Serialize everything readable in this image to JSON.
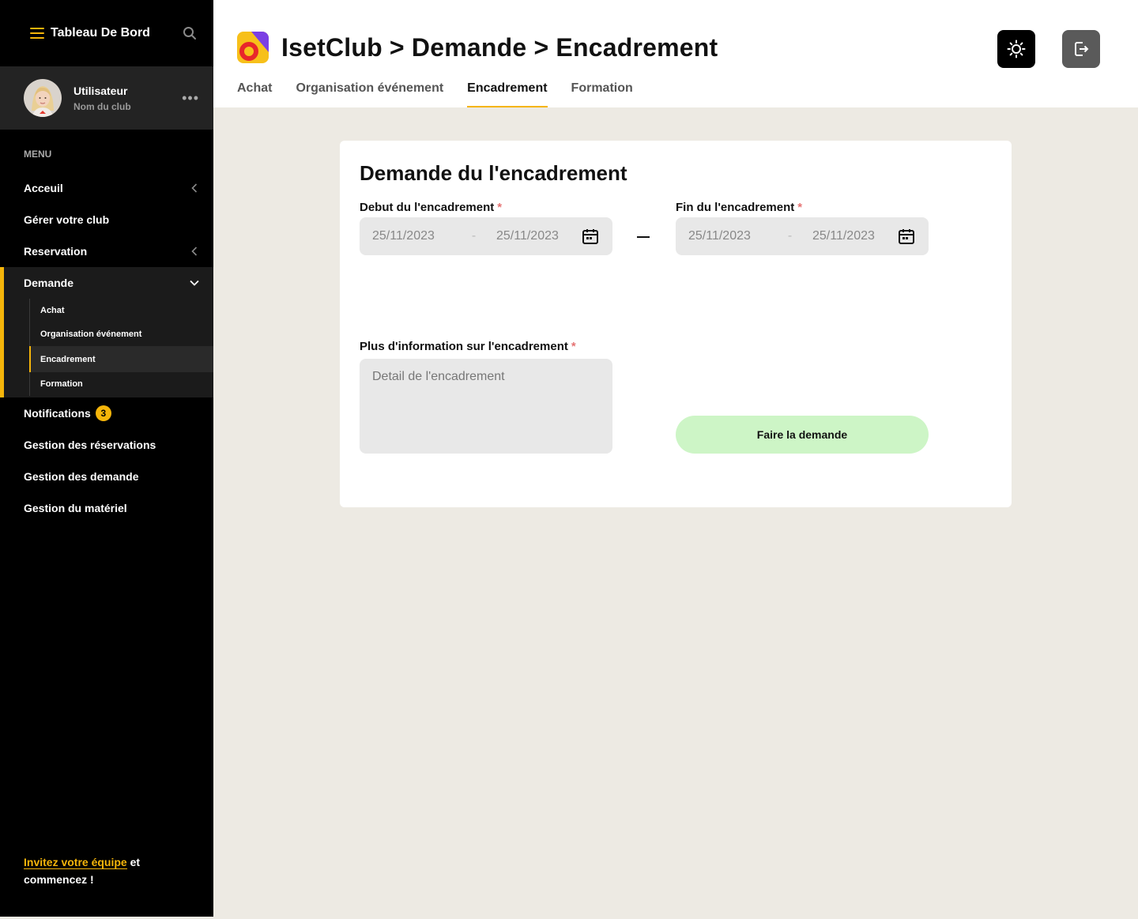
{
  "sidebar": {
    "brand": "Tableau De Bord",
    "user": {
      "name": "Utilisateur",
      "club": "Nom du club"
    },
    "menu_label": "MENU",
    "items": [
      {
        "label": "Acceuil"
      },
      {
        "label": "Gérer votre club"
      },
      {
        "label": "Reservation"
      },
      {
        "label": "Demande"
      },
      {
        "label": "Notifications",
        "badge": "3"
      },
      {
        "label": "Gestion des réservations"
      },
      {
        "label": "Gestion des demande"
      },
      {
        "label": "Gestion du matériel"
      }
    ],
    "demande_sub": [
      {
        "label": "Achat"
      },
      {
        "label": "Organisation événement"
      },
      {
        "label": "Encadrement"
      },
      {
        "label": "Formation"
      }
    ],
    "invite_link": "Invitez votre équipe",
    "invite_rest": " et commencez !"
  },
  "header": {
    "title": "IsetClub > Demande > Encadrement",
    "tabs": [
      {
        "label": "Achat"
      },
      {
        "label": "Organisation événement"
      },
      {
        "label": "Encadrement"
      },
      {
        "label": "Formation"
      }
    ]
  },
  "form": {
    "title": "Demande du l'encadrement",
    "debut_label": "Debut du l'encadrement",
    "fin_label": "Fin du l'encadrement",
    "required_mark": "*",
    "debut": {
      "start": "25/11/2023",
      "end": "25/11/2023",
      "sep": "-"
    },
    "fin": {
      "start": "25/11/2023",
      "end": "25/11/2023",
      "sep": "-"
    },
    "info_label": "Plus d'information sur l'encadrement",
    "info_placeholder": "Detail de l'encadrement",
    "submit_label": "Faire la demande"
  },
  "colors": {
    "accent": "#f5b50a",
    "sidebar_bg": "#000000",
    "submit_bg": "#cdf5c6",
    "page_bg": "#edeae3"
  }
}
